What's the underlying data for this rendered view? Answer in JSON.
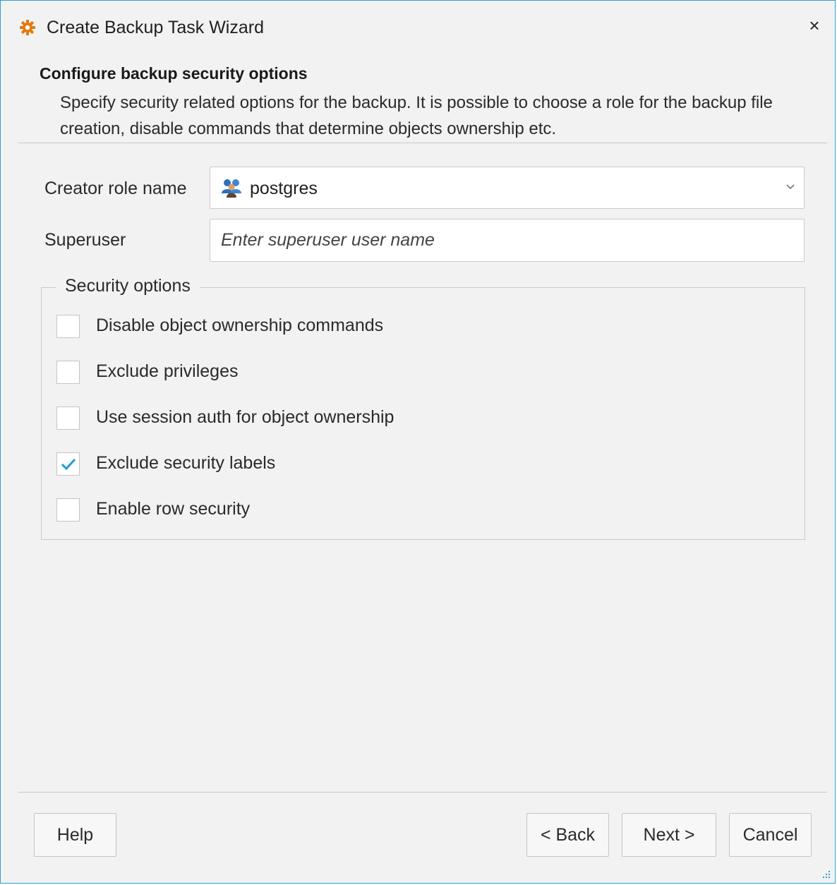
{
  "window": {
    "title": "Create Backup Task Wizard",
    "close_glyph": "×",
    "accent": "#2a9fd6",
    "icon": "gear-icon",
    "icon_color": "#e07b10"
  },
  "header": {
    "title": "Configure backup security options",
    "description": "Specify security related options for the backup. It is possible to choose a role for the backup file creation, disable commands that determine objects ownership etc."
  },
  "form": {
    "creator_role": {
      "label": "Creator role name",
      "value": "postgres",
      "icon": "users-icon"
    },
    "superuser": {
      "label": "Superuser",
      "value": "",
      "placeholder": "Enter superuser user name"
    }
  },
  "security_options": {
    "legend": "Security options",
    "items": [
      {
        "label": "Disable object ownership commands",
        "checked": false
      },
      {
        "label": "Exclude privileges",
        "checked": false
      },
      {
        "label": "Use session auth for object ownership",
        "checked": false
      },
      {
        "label": "Exclude security labels",
        "checked": true
      },
      {
        "label": "Enable row security",
        "checked": false
      }
    ],
    "check_color": "#1e9bd7"
  },
  "buttons": {
    "help": "Help",
    "back": "< Back",
    "next": "Next >",
    "cancel": "Cancel"
  }
}
